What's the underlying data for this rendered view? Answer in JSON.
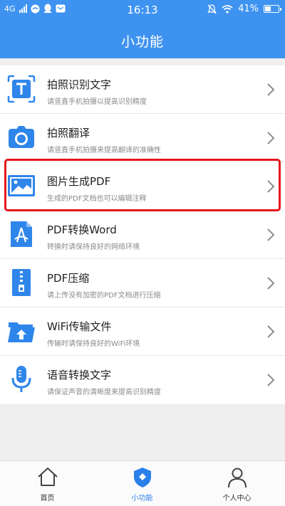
{
  "statusbar": {
    "network": "4G",
    "time": "16:13",
    "battery": "41%"
  },
  "header": {
    "title": "小功能"
  },
  "features": [
    {
      "label": "拍照识别文字",
      "sub": "请竖直手机拍摄以提高识别精度",
      "icon": "text-scan-icon"
    },
    {
      "label": "拍照翻译",
      "sub": "请竖直手机拍摄来提高翻译的准确性",
      "icon": "camera-icon"
    },
    {
      "label": "图片生成PDF",
      "sub": "生成的PDF文档也可以编辑注释",
      "icon": "image-icon"
    },
    {
      "label": "PDF转换Word",
      "sub": "转换时请保持良好的网络环境",
      "icon": "pdf-icon"
    },
    {
      "label": "PDF压缩",
      "sub": "请上传没有加密的PDF文档进行压缩",
      "icon": "zip-icon"
    },
    {
      "label": "WiFi传输文件",
      "sub": "传输时请保持良好的WiFi环境",
      "icon": "folder-upload-icon"
    },
    {
      "label": "语音转换文字",
      "sub": "请保证声音的清晰度来提高识别精度",
      "icon": "microphone-icon"
    }
  ],
  "tabs": [
    {
      "label": "首页",
      "icon": "home-icon",
      "active": false
    },
    {
      "label": "小功能",
      "icon": "shield-icon",
      "active": true
    },
    {
      "label": "个人中心",
      "icon": "person-icon",
      "active": false
    }
  ],
  "colors": {
    "primary": "#3f93f0",
    "highlight": "#e5161b",
    "active_tab": "#2b7fe8"
  }
}
